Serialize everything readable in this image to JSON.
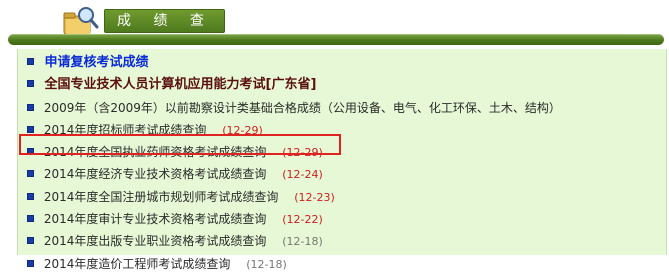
{
  "header": {
    "title": "成 绩 查 询",
    "icon": "folder-search-icon",
    "colors": {
      "bar": "#4d7a1d",
      "panel": "#e6f8d5",
      "highlight": "#e02222"
    }
  },
  "items": [
    {
      "label": "申请复核考试成绩",
      "date": ""
    },
    {
      "label": "全国专业技术人员计算机应用能力考试[广东省]",
      "date": ""
    },
    {
      "label": "2009年（含2009年）以前勘察设计类基础合格成绩（公用设备、电气、化工环保、土木、结构）",
      "date": ""
    },
    {
      "label": "2014年度招标师考试成绩查询",
      "date": "(12-29)"
    },
    {
      "label": "2014年度全国执业药师资格考试成绩查询",
      "date": "(12-29)"
    },
    {
      "label": "2014年度经济专业技术资格考试成绩查询",
      "date": "(12-24)"
    },
    {
      "label": "2014年度全国注册城市规划师考试成绩查询",
      "date": "(12-23)"
    },
    {
      "label": "2014年度审计专业技术资格考试成绩查询",
      "date": "(12-22)"
    },
    {
      "label": "2014年度出版专业职业资格考试成绩查询",
      "date": "(12-18)"
    },
    {
      "label": "2014年度造价工程师考试成绩查询",
      "date": "(12-18)"
    }
  ]
}
